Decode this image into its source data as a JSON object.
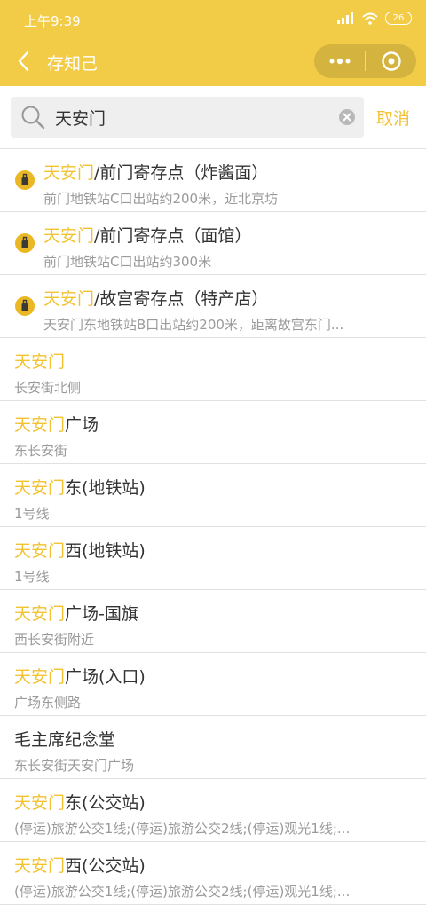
{
  "status_bar": {
    "time": "上午9:39",
    "battery": "26"
  },
  "nav": {
    "title": "存知己"
  },
  "search": {
    "value": "天安门",
    "cancel_label": "取消"
  },
  "colors": {
    "brand": "#f2cc47",
    "highlight": "#f2c230",
    "subtext": "#9a9a9a"
  },
  "results": [
    {
      "kind": "storage",
      "hl": "天安门",
      "rest": "/前门寄存点（炸酱面）",
      "sub": "前门地铁站C口出站约200米，近北京坊"
    },
    {
      "kind": "storage",
      "hl": "天安门",
      "rest": "/前门寄存点（面馆）",
      "sub": "前门地铁站C口出站约300米"
    },
    {
      "kind": "storage",
      "hl": "天安门",
      "rest": "/故宫寄存点（特产店）",
      "sub": "天安门东地铁站B口出站约200米，距离故宫东门..."
    },
    {
      "kind": "place",
      "hl": "天安门",
      "rest": "",
      "sub": "长安街北侧"
    },
    {
      "kind": "place",
      "hl": "天安门",
      "rest": "广场",
      "sub": "东长安街"
    },
    {
      "kind": "place",
      "hl": "天安门",
      "rest": "东(地铁站)",
      "sub": "1号线"
    },
    {
      "kind": "place",
      "hl": "天安门",
      "rest": "西(地铁站)",
      "sub": "1号线"
    },
    {
      "kind": "place",
      "hl": "天安门",
      "rest": "广场-国旗",
      "sub": "西长安街附近"
    },
    {
      "kind": "place",
      "hl": "天安门",
      "rest": "广场(入口)",
      "sub": "广场东侧路"
    },
    {
      "kind": "place",
      "hl": "",
      "rest": "毛主席纪念堂",
      "sub": "东长安街天安门广场"
    },
    {
      "kind": "place",
      "hl": "天安门",
      "rest": "东(公交站)",
      "sub": "(停运)旅游公交1线;(停运)旅游公交2线;(停运)观光1线;..."
    },
    {
      "kind": "place",
      "hl": "天安门",
      "rest": "西(公交站)",
      "sub": "(停运)旅游公交1线;(停运)旅游公交2线;(停运)观光1线;..."
    }
  ]
}
